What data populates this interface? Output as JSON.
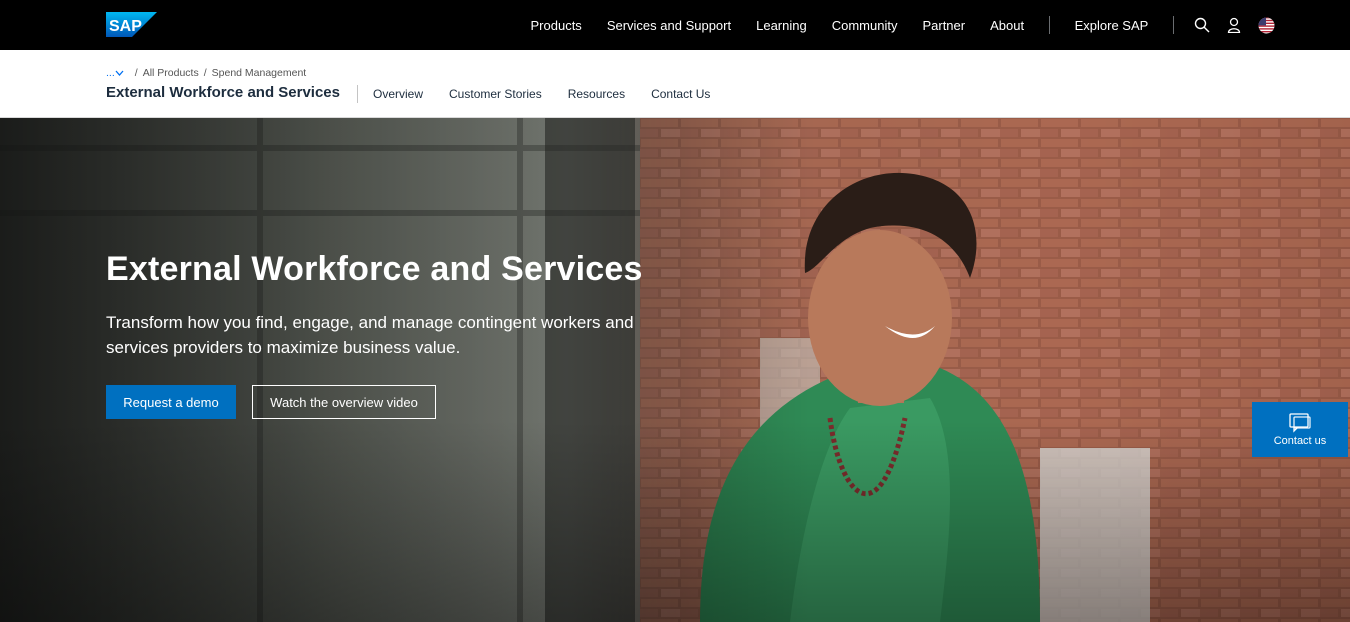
{
  "nav": {
    "logo_text": "SAP",
    "links": [
      "Products",
      "Services and Support",
      "Learning",
      "Community",
      "Partner",
      "About"
    ],
    "explore": "Explore SAP",
    "icons": [
      "search-icon",
      "user-icon",
      "us-flag-icon"
    ]
  },
  "breadcrumb": {
    "ellipsis": "...",
    "items": [
      "All Products",
      "Spend Management"
    ],
    "separator": "/"
  },
  "subnav": {
    "title": "External Workforce and Services",
    "tabs": [
      "Overview",
      "Customer Stories",
      "Resources",
      "Contact Us"
    ]
  },
  "hero": {
    "title": "External Workforce and Services",
    "subtitle": "Transform how you find, engage, and manage contingent workers and services providers to maximize business value.",
    "primary_button": "Request a demo",
    "secondary_button": "Watch the overview video"
  },
  "contact_widget": {
    "label": "Contact us"
  },
  "colors": {
    "accent": "#0070c0",
    "topbar": "#000000"
  }
}
